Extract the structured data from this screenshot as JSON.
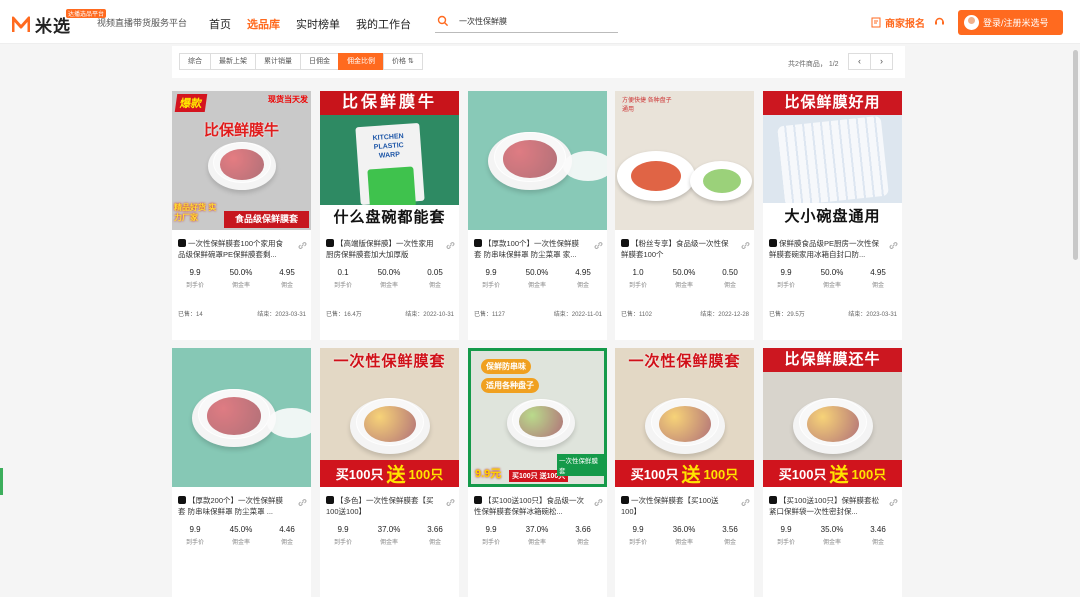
{
  "brand": {
    "name": "米选",
    "badge": "达播选品平台",
    "tagline": "视频直播带货服务平台"
  },
  "nav": [
    "首页",
    "选品库",
    "实时榜单",
    "我的工作台"
  ],
  "search": {
    "value": "一次性保鲜膜"
  },
  "header": {
    "merchant": "商家报名",
    "login": "登录/注册米选号"
  },
  "sort": {
    "options": [
      "综合",
      "最新上架",
      "累计销量",
      "日佣金",
      "佣金比例",
      "价格 ⇅"
    ],
    "active": 4
  },
  "pagination": {
    "info": "共2件商品， 1/2",
    "prev": "‹",
    "next": "›"
  },
  "stat_labels": {
    "price": "到手价",
    "rate": "佣金率",
    "commission": "佣金"
  },
  "meta_labels": {
    "sold": "已售：",
    "end": "结束："
  },
  "products": [
    {
      "title": "一次性保鲜膜套100个家用食品级保鲜碗罩PE保鲜膜套剩...",
      "price": "9.9",
      "rate": "50.0%",
      "commission": "4.95",
      "sold": "14",
      "end": "2023-03-31",
      "img": {
        "bg": "#c9c9c9",
        "top": "爆款",
        "top2": "现货当天发",
        "mid": "比保鲜膜牛",
        "foot": "食品级保鲜膜套",
        "sub": "精品好货 实力厂家"
      }
    },
    {
      "title": "【高端版保鲜膜】一次性家用厨房保鲜膜套加大加厚版",
      "price": "0.1",
      "rate": "50.0%",
      "commission": "0.05",
      "sold": "16.4万",
      "end": "2022-10-31",
      "img": {
        "bg": "#2e8a63",
        "top": "比保鲜膜牛",
        "foot": "什么盘碗都能套",
        "pkg": "KITCHEN PLASTIC WARP"
      }
    },
    {
      "title": "【厚款100个】一次性保鲜膜套 防串味保鲜罩 防尘菜罩 家...",
      "price": "9.9",
      "rate": "50.0%",
      "commission": "4.95",
      "sold": "1127",
      "end": "2022-11-01",
      "img": {
        "bg": "#88c9b7"
      }
    },
    {
      "title": "【粉丝专享】食品级一次性保鲜膜套100个",
      "price": "1.0",
      "rate": "50.0%",
      "commission": "0.50",
      "sold": "1102",
      "end": "2022-12-28",
      "img": {
        "bg": "#e9e3d9",
        "cap": "方便快捷 各种盘子通用"
      }
    },
    {
      "title": "保鲜膜食品级PE厨房一次性保鲜膜套碗家用冰箱自封口防...",
      "price": "9.9",
      "rate": "50.0%",
      "commission": "4.95",
      "sold": "29.5万",
      "end": "2023-03-31",
      "img": {
        "bg": "#dde6ef",
        "top": "比保鲜膜好用",
        "foot": "大小碗盘通用"
      }
    },
    {
      "title": "【厚款200个】一次性保鲜膜套 防串味保鲜罩 防尘菜罩 ...",
      "price": "9.9",
      "rate": "45.0%",
      "commission": "4.46",
      "img": {
        "bg": "#86c8b5"
      }
    },
    {
      "title": "【多色】一次性保鲜膜套【买100送100】",
      "price": "9.9",
      "rate": "37.0%",
      "commission": "3.66",
      "img": {
        "bg": "#e3d8c5",
        "top": "一次性保鲜膜套",
        "foot1": "买100只",
        "foot2": "送",
        "foot3": "100只"
      }
    },
    {
      "title": "【买100送100只】食品级一次性保鲜膜套保鲜冰箱碗松...",
      "price": "9.9",
      "rate": "37.0%",
      "commission": "3.66",
      "img": {
        "bg": "#dfe4dc",
        "tag1": "保鲜防串味",
        "tag2": "适用各种盘子",
        "price": "9.9元",
        "deal": "买100只 送100只",
        "name": "一次性保鲜膜套"
      }
    },
    {
      "title": "一次性保鲜膜套【买100送100】",
      "price": "9.9",
      "rate": "36.0%",
      "commission": "3.56",
      "img": {
        "bg": "#e3d8c5",
        "top": "一次性保鲜膜套",
        "foot1": "买100只",
        "foot2": "送",
        "foot3": "100只"
      }
    },
    {
      "title": "【买100送100只】保鲜膜套松紧口保鲜袋一次性密封保...",
      "price": "9.9",
      "rate": "35.0%",
      "commission": "3.46",
      "img": {
        "bg": "#d8d4cc",
        "top": "比保鲜膜还牛",
        "foot1": "买100只",
        "foot2": "送",
        "foot3": "100只"
      }
    }
  ]
}
